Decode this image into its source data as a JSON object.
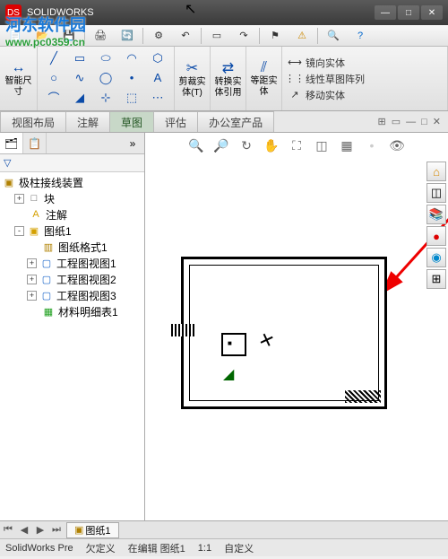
{
  "titlebar": {
    "app": "SOLIDWORKS"
  },
  "watermark": {
    "line1": "河东软件园",
    "line2": "www.pc0359.cn"
  },
  "menubar_icons": [
    "new",
    "open",
    "save",
    "print",
    "rebuild",
    "options",
    "undo",
    "redo",
    "select",
    "macro",
    "flag",
    "error",
    "search",
    "help"
  ],
  "ribbon": {
    "dim": {
      "label": "智能尺\n寸"
    },
    "sketch_tools": [
      "/",
      "□",
      "◯",
      "◠",
      "⬡",
      "⌒",
      "A",
      "•",
      "≡",
      "⬚",
      "⟋",
      "◐",
      "∿",
      "⤴",
      "⋯"
    ],
    "trim": "剪裁实\n体(T)",
    "convert": "转换实\n体引用",
    "offset": "等距实\n体",
    "rows": [
      {
        "icon": "⟷",
        "label": "镜向实体"
      },
      {
        "icon": "⋮⋮",
        "label": "线性草图阵列"
      },
      {
        "icon": "↗",
        "label": "移动实体"
      }
    ]
  },
  "tabs": [
    "视图布局",
    "注解",
    "草图",
    "评估",
    "办公室产品"
  ],
  "active_tab": 2,
  "doc_controls": [
    "⊞",
    "▭",
    "—",
    "□",
    "✕"
  ],
  "tree": {
    "root": "极柱接线装置",
    "items": [
      {
        "tw": "+",
        "icon": "□",
        "label": "块",
        "indent": 1
      },
      {
        "tw": "",
        "icon": "A",
        "label": "注解",
        "indent": 1,
        "icolor": "#d4a000"
      },
      {
        "tw": "-",
        "icon": "▣",
        "label": "图纸1",
        "indent": 1,
        "icolor": "#d4a000"
      },
      {
        "tw": "",
        "icon": "▥",
        "label": "图纸格式1",
        "indent": 2,
        "icolor": "#b08000"
      },
      {
        "tw": "+",
        "icon": "▢",
        "label": "工程图视图1",
        "indent": 2,
        "icolor": "#1864c8"
      },
      {
        "tw": "+",
        "icon": "▢",
        "label": "工程图视图2",
        "indent": 2,
        "icolor": "#1864c8"
      },
      {
        "tw": "+",
        "icon": "▢",
        "label": "工程图视图3",
        "indent": 2,
        "icolor": "#1864c8"
      },
      {
        "tw": "",
        "icon": "▦",
        "label": "材料明细表1",
        "indent": 2,
        "icolor": "#20a020"
      }
    ]
  },
  "view_toolbar": [
    "🔍",
    "🔍",
    "↻",
    "↺",
    "⟳",
    "🖨",
    "◫",
    "⛶",
    "👁"
  ],
  "side_tools": [
    {
      "g": "🏠",
      "c": "#d48800"
    },
    {
      "g": "◫",
      "c": "#666"
    },
    {
      "g": "📋",
      "c": "#666"
    },
    {
      "g": "◐",
      "c": "#d00"
    },
    {
      "g": "◉",
      "c": "#08c"
    },
    {
      "g": "⊞",
      "c": "#888"
    }
  ],
  "bottom_tab": {
    "icon": "▣",
    "label": "图纸1"
  },
  "status": {
    "app": "SolidWorks Pre",
    "s1": "欠定义",
    "s2": "在编辑 图纸1",
    "s3": "1:1",
    "s4": "自定义"
  }
}
